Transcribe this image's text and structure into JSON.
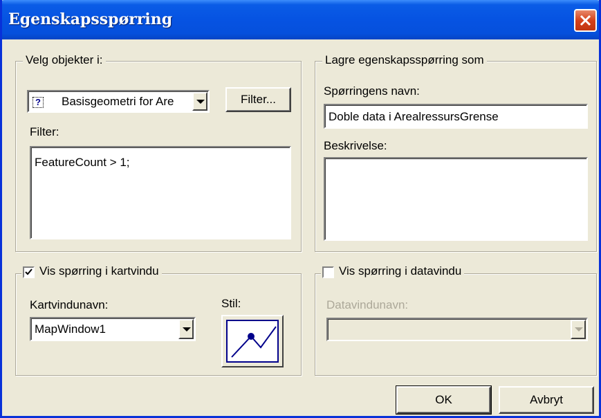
{
  "window": {
    "title": "Egenskapsspørring"
  },
  "select_group": {
    "legend": "Velg objekter i:",
    "source_value": "Basisgeometri for Are",
    "source_icon": "question-mark-icon",
    "filter_button_label": "Filter...",
    "filter_label": "Filter:",
    "filter_text": "FeatureCount  > 1;"
  },
  "save_group": {
    "legend": "Lagre egenskapsspørring som",
    "name_label": "Spørringens navn:",
    "name_value": "Doble data i ArealressursGrense",
    "description_label": "Beskrivelse:",
    "description_value": ""
  },
  "map_group": {
    "checkbox_label": "Vis spørring i kartvindu",
    "checked": true,
    "map_name_label": "Kartvindunavn:",
    "map_name_value": "MapWindow1",
    "style_label": "Stil:"
  },
  "data_group": {
    "checkbox_label": "Vis spørring i datavindu",
    "checked": false,
    "data_name_label": "Datavindunavn:",
    "data_name_value": ""
  },
  "buttons": {
    "ok": "OK",
    "cancel": "Avbryt"
  },
  "colors": {
    "titlebar": "#0653e2",
    "dialog_bg": "#ece9d8",
    "close_button": "#d5411b",
    "style_line": "#00008b"
  }
}
